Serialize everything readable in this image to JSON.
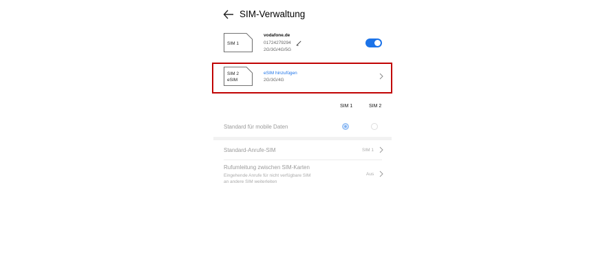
{
  "header": {
    "title": "SIM-Verwaltung"
  },
  "sim1": {
    "card_label": "SIM 1",
    "carrier": "vodafone.de",
    "number": "01724279294",
    "networks": "2G/3G/4G/5G",
    "enabled": true
  },
  "sim2": {
    "card_label": "SIM 2",
    "card_sub": "eSIM",
    "action": "eSIM hinzufügen",
    "networks": "2G/3G/4G"
  },
  "columns": {
    "sim1": "SIM 1",
    "sim2": "SIM 2"
  },
  "settings": {
    "mobile_data_label": "Standard für mobile Daten",
    "default_calls_label": "Standard-Anrufe-SIM",
    "default_calls_value": "SIM 1",
    "forwarding_label": "Rufumleitung zwischen SIM-Karten",
    "forwarding_desc_1": "Eingehende Anrufe für nicht verfügbare SIM",
    "forwarding_desc_2": "an andere SIM weiterleiten",
    "forwarding_value": "Aus"
  },
  "colors": {
    "accent": "#1c73e8",
    "highlight_border": "#c00000"
  },
  "icons": [
    "back-arrow-icon",
    "edit-pencil-icon",
    "chevron-right-icon"
  ]
}
